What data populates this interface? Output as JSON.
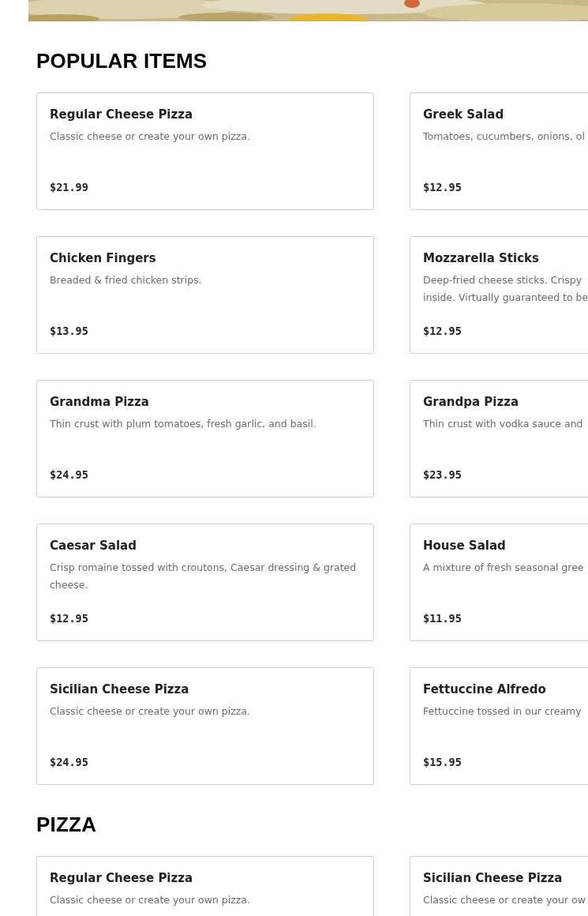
{
  "sections": [
    {
      "title": "POPULAR ITEMS",
      "items": [
        {
          "name": "Regular Cheese Pizza",
          "description": [
            "Classic cheese or create your own pizza."
          ],
          "price": "$21.99"
        },
        {
          "name": "Greek Salad",
          "description": [
            "Tomatoes, cucumbers, onions, ol"
          ],
          "price": "$12.95"
        },
        {
          "name": "Chicken Fingers",
          "description": [
            "Breaded & fried chicken strips."
          ],
          "price": "$13.95"
        },
        {
          "name": "Mozzarella Sticks",
          "description": [
            "Deep-fried cheese sticks. Crispy",
            "inside. Virtually guaranteed to be"
          ],
          "price": "$12.95"
        },
        {
          "name": "Grandma Pizza",
          "description": [
            "Thin crust with plum tomatoes, fresh garlic, and basil."
          ],
          "price": "$24.95"
        },
        {
          "name": "Grandpa Pizza",
          "description": [
            "Thin crust with vodka sauce and"
          ],
          "price": "$23.95"
        },
        {
          "name": "Caesar Salad",
          "description": [
            "Crisp romaine tossed with croutons, Caesar dressing & grated",
            "cheese."
          ],
          "price": "$12.95"
        },
        {
          "name": "House Salad",
          "description": [
            "A mixture of fresh seasonal gree"
          ],
          "price": "$11.95"
        },
        {
          "name": "Sicilian Cheese Pizza",
          "description": [
            "Classic cheese or create your own pizza."
          ],
          "price": "$24.95"
        },
        {
          "name": "Fettuccine Alfredo",
          "description": [
            "Fettuccine tossed in our creamy"
          ],
          "price": "$15.95"
        }
      ]
    },
    {
      "title": "PIZZA",
      "items": [
        {
          "name": "Regular Cheese Pizza",
          "description": [
            "Classic cheese or create your own pizza."
          ]
        },
        {
          "name": "Sicilian Cheese Pizza",
          "description": [
            "Classic cheese or create your ow"
          ]
        }
      ]
    }
  ]
}
